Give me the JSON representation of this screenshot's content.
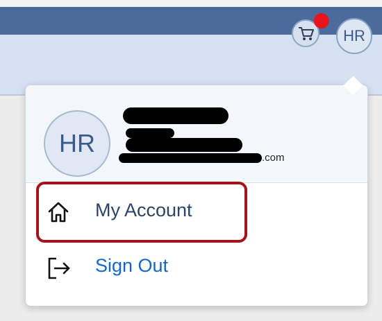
{
  "header": {
    "cart_icon": "cart-icon",
    "notification_color": "#e8141c",
    "avatar_initials": "HR"
  },
  "profile": {
    "initials": "HR",
    "email_suffix": ".com"
  },
  "menu": {
    "items": [
      {
        "label": "My Account",
        "icon": "home-icon"
      },
      {
        "label": "Sign Out",
        "icon": "sign-out-icon"
      }
    ]
  },
  "colors": {
    "navbar": "#4a6b9c",
    "highlight": "#a3131b",
    "link": "#1566c5"
  }
}
